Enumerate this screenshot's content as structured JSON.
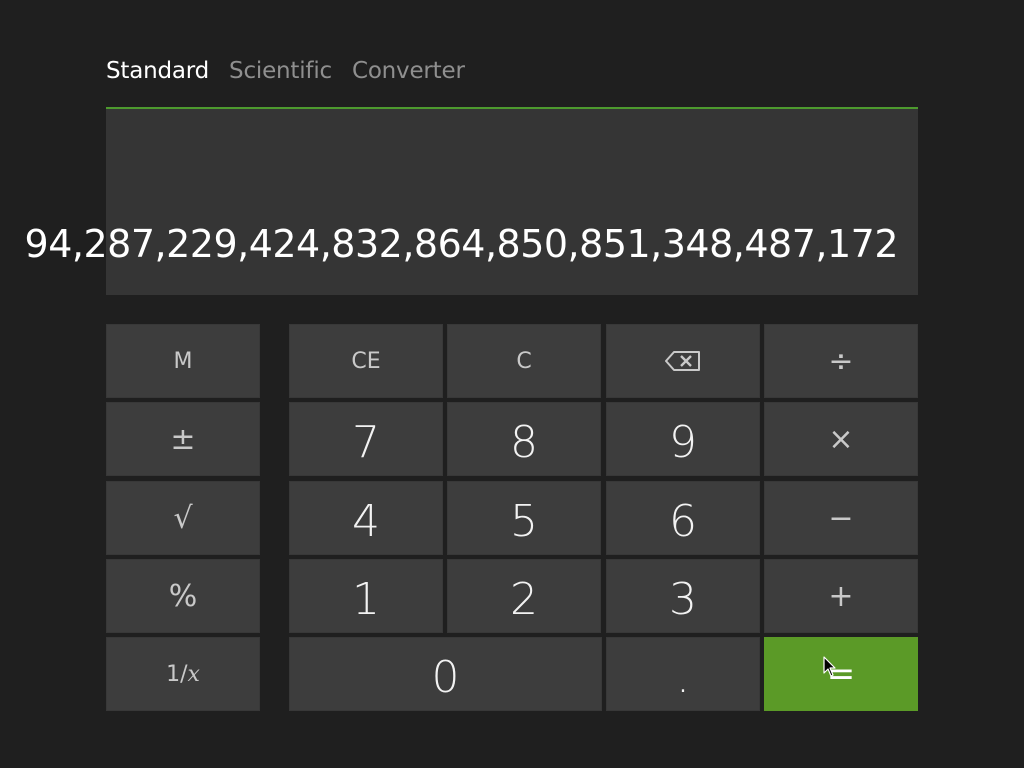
{
  "tabs": [
    {
      "label": "Standard",
      "active": true
    },
    {
      "label": "Scientific",
      "active": false
    },
    {
      "label": "Converter",
      "active": false
    }
  ],
  "display": {
    "value": "94,287,229,424,832,864,850,851,348,487,172"
  },
  "keys": {
    "memory": "M",
    "negate": "±",
    "sqrt": "√",
    "percent": "%",
    "reciprocal_prefix": "1/",
    "reciprocal_var": "x",
    "clear_entry": "CE",
    "clear": "C",
    "backspace": "backspace-icon",
    "divide": "÷",
    "multiply": "×",
    "subtract": "−",
    "add": "+",
    "equals": "=",
    "decimal": ".",
    "d0": "0",
    "d1": "1",
    "d2": "2",
    "d3": "3",
    "d4": "4",
    "d5": "5",
    "d6": "6",
    "d7": "7",
    "d8": "8",
    "d9": "9"
  },
  "colors": {
    "background": "#1f1f1f",
    "display": "#353535",
    "key": "#3d3d3d",
    "accent": "#5b9a27",
    "tab_underline": "#4d9a2e"
  }
}
